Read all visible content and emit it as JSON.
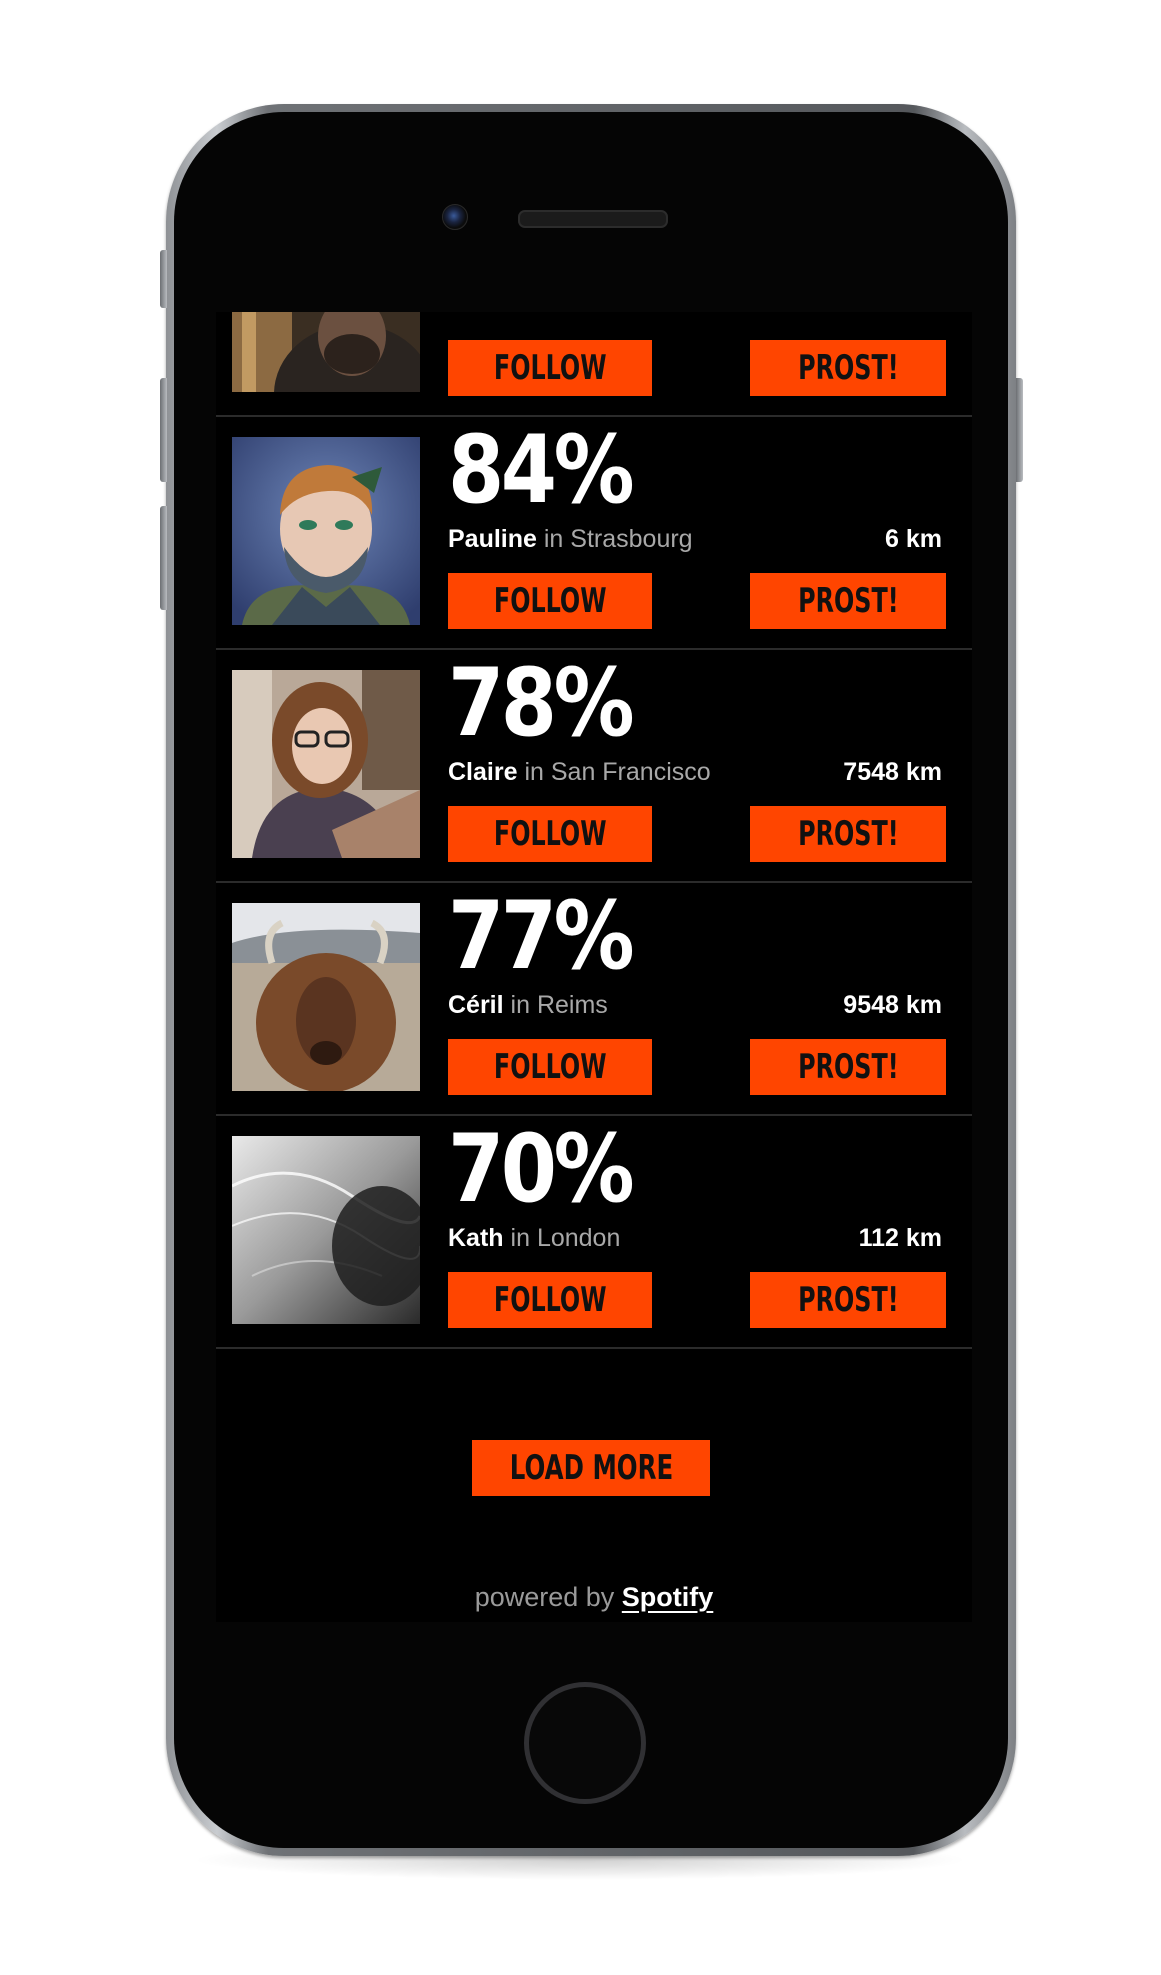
{
  "colors": {
    "accent": "#ff4500",
    "background": "#000000",
    "text_primary": "#ffffff",
    "text_secondary": "#a8a8a8"
  },
  "list": {
    "partial_row": {
      "follow_label": "FOLLOW",
      "prost_label": "PROST!"
    },
    "rows": [
      {
        "match": "84%",
        "name": "Pauline",
        "in_word": "in",
        "city": "Strasbourg",
        "distance": "6 km",
        "follow_label": "FOLLOW",
        "prost_label": "PROST!"
      },
      {
        "match": "78%",
        "name": "Claire",
        "in_word": "in",
        "city": "San Francisco",
        "distance": "7548 km",
        "follow_label": "FOLLOW",
        "prost_label": "PROST!"
      },
      {
        "match": "77%",
        "name": "Céril",
        "in_word": "in",
        "city": "Reims",
        "distance": "9548 km",
        "follow_label": "FOLLOW",
        "prost_label": "PROST!"
      },
      {
        "match": "70%",
        "name": "Kath",
        "in_word": "in",
        "city": "London",
        "distance": "112 km",
        "follow_label": "FOLLOW",
        "prost_label": "PROST!"
      }
    ]
  },
  "load_more_label": "LOAD MORE",
  "footer": {
    "prefix": "powered by",
    "brand": "Spotify"
  }
}
